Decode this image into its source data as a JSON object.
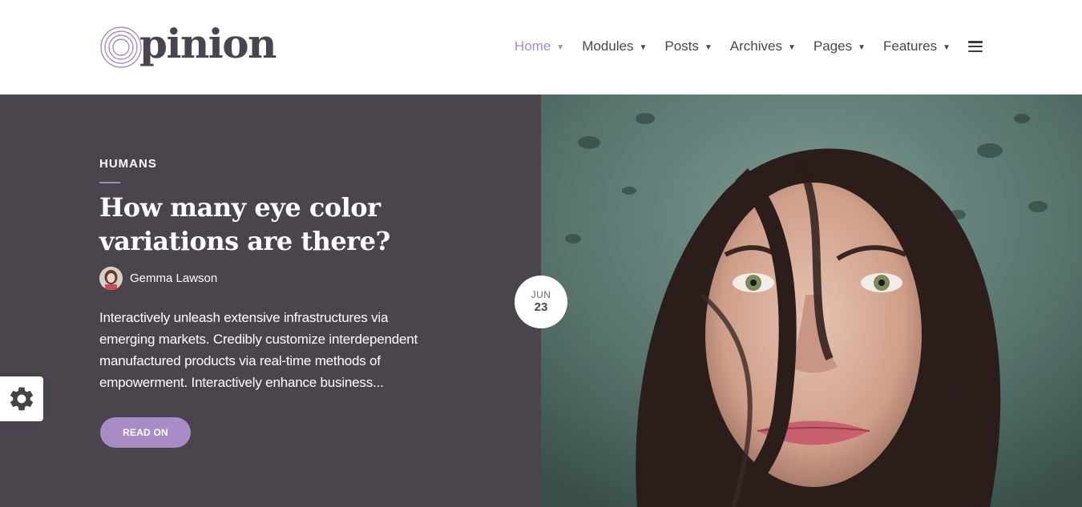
{
  "brand": {
    "name": "pinion",
    "logo_icon": "concentric-o-icon"
  },
  "nav": {
    "items": [
      {
        "label": "Home",
        "active": true
      },
      {
        "label": "Modules",
        "active": false
      },
      {
        "label": "Posts",
        "active": false
      },
      {
        "label": "Archives",
        "active": false
      },
      {
        "label": "Pages",
        "active": false
      },
      {
        "label": "Features",
        "active": false
      }
    ],
    "menu_icon": "hamburger-icon"
  },
  "hero": {
    "category": "HUMANS",
    "title": "How many eye color variations are there?",
    "author": "Gemma Lawson",
    "excerpt": "Interactively unleash extensive infrastructures via emerging markets. Credibly customize interdependent manufactured products via real-time methods of empowerment. Interactively enhance business...",
    "button": "READ ON",
    "date": {
      "month": "JUN",
      "day": "23"
    }
  },
  "settings": {
    "icon": "gear-icon"
  },
  "colors": {
    "accent": "#a98bc6",
    "hero_bg": "#4a444d",
    "text_dark": "#4a4450"
  }
}
